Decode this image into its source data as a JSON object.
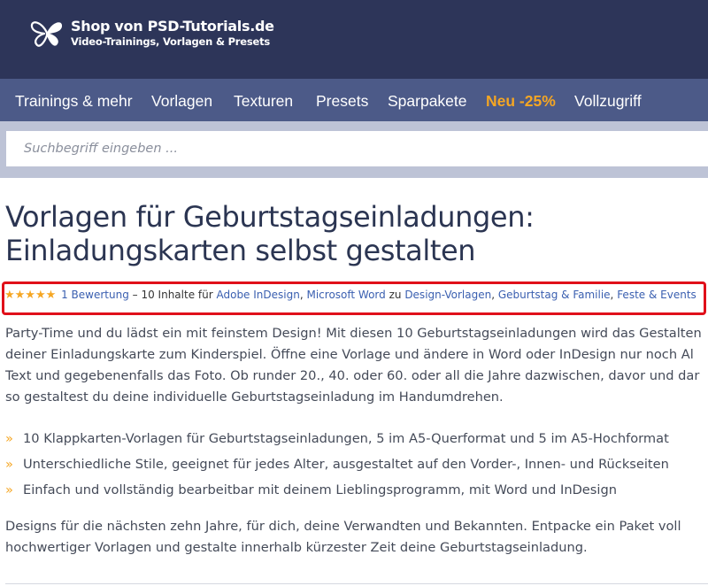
{
  "header": {
    "logo_icon": "butterfly-logo-icon",
    "title": "Shop von PSD-Tutorials.de",
    "subtitle": "Video-Trainings, Vorlagen & Presets"
  },
  "nav": {
    "items": [
      {
        "label": "Trainings & mehr"
      },
      {
        "label": "Vorlagen"
      },
      {
        "label": "Texturen"
      },
      {
        "label": "Presets"
      },
      {
        "label": "Sparpakete"
      },
      {
        "label": "Neu -25%",
        "highlight": true
      },
      {
        "label": "Vollzugriff"
      }
    ]
  },
  "search": {
    "placeholder": "Suchbegriff eingeben ..."
  },
  "page": {
    "title_line1": "Vorlagen für Geburtstagseinladungen:",
    "title_line2": "Einladungskarten selbst gestalten"
  },
  "meta": {
    "rating_stars": 5,
    "stars": "★★★★★",
    "rating_link": "1 Bewertung",
    "text_count": " – 10 Inhalte für ",
    "app1": "Adobe InDesign",
    "sep1": ", ",
    "app2": "Microsoft Word",
    "text_zu": " zu ",
    "cat1": "Design-Vorlagen",
    "sep2": ", ",
    "cat2": "Geburtstag & Familie",
    "sep3": ", ",
    "cat3": "Feste & Events",
    "highlight_color": "#e0101a"
  },
  "description": {
    "lines": [
      "Party-Time und du lädst ein mit feinstem Design! Mit diesen 10 Geburtstagseinladungen wird das Gestalten",
      "deiner Einladungskarte zum Kinderspiel. Öffne eine Vorlage und ändere in Word oder InDesign nur noch Al",
      "Text und gegebenenfalls das Foto. Ob runder 20., 40. oder 60. oder all die Jahre dazwischen, davor und dar",
      "so gestaltest du deine individuelle Geburtstagseinladung im Handumdrehen."
    ]
  },
  "features": {
    "bullet": "»",
    "items": [
      "10 Klappkarten-Vorlagen für Geburtstagseinladungen, 5 im A5-Querformat und 5 im A5-Hochformat",
      "Unterschiedliche Stile, geeignet für jedes Alter, ausgestaltet auf den Vorder-, Innen- und Rückseiten",
      "Einfach und vollständig bearbeitbar mit deinem Lieblingsprogramm, mit Word und InDesign"
    ]
  },
  "outro": {
    "lines": [
      "Designs für die nächsten zehn Jahre, für dich, deine Verwandten und Bekannten. Entpacke ein Paket voll",
      "hochwertiger Vorlagen und gestalte innerhalb kürzester Zeit deine Geburtstagseinladung."
    ]
  },
  "colors": {
    "header_bg": "#2d3559",
    "nav_bg": "#4c5a88",
    "accent": "#f5a623",
    "link": "#3a5fb0"
  }
}
